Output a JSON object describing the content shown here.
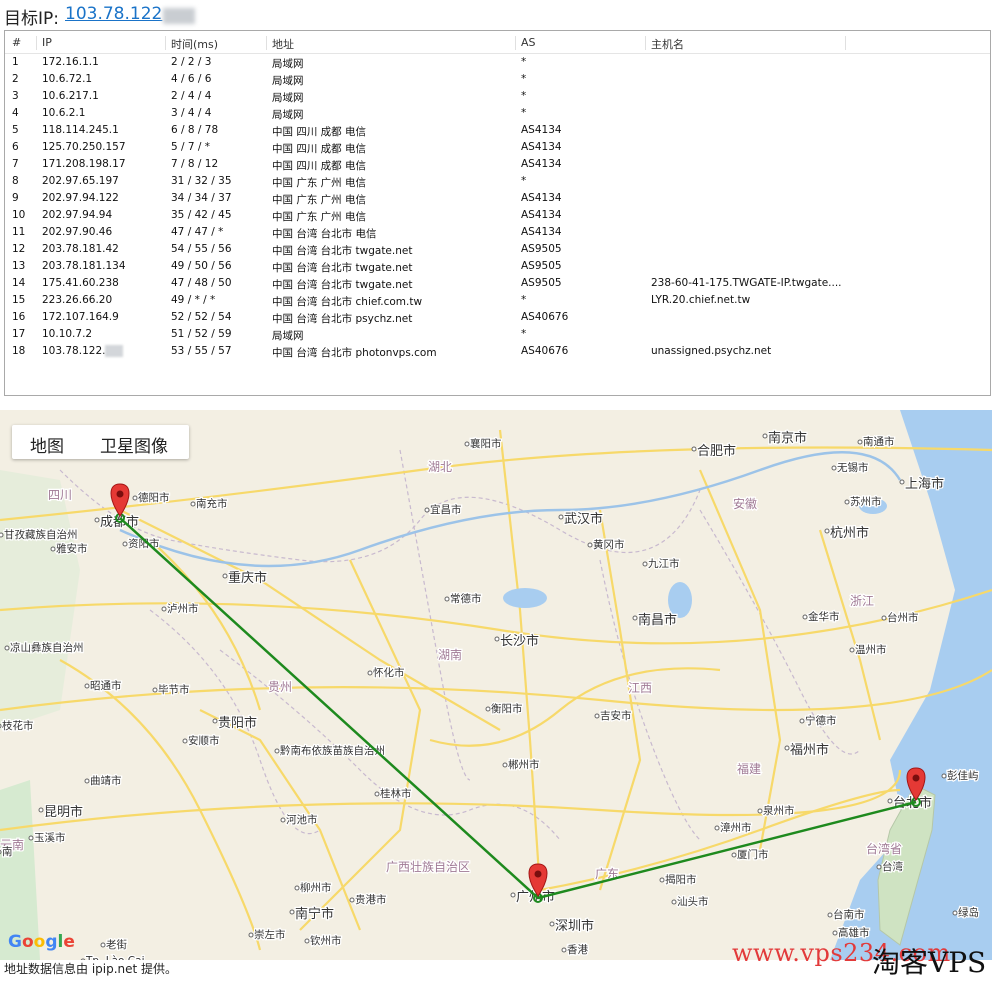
{
  "header": {
    "label": "目标IP:",
    "ip": "103.78.122"
  },
  "table": {
    "columns": [
      "#",
      "IP",
      "时间(ms)",
      "地址",
      "AS",
      "主机名"
    ],
    "rows": [
      [
        "1",
        "172.16.1.1",
        "2 / 2 / 3",
        "局域网",
        "*",
        ""
      ],
      [
        "2",
        "10.6.72.1",
        "4 / 6 / 6",
        "局域网",
        "*",
        ""
      ],
      [
        "3",
        "10.6.217.1",
        "2 / 4 / 4",
        "局域网",
        "*",
        ""
      ],
      [
        "4",
        "10.6.2.1",
        "3 / 4 / 4",
        "局域网",
        "*",
        ""
      ],
      [
        "5",
        "118.114.245.1",
        "6 / 8 / 78",
        "中国 四川 成都 电信",
        "AS4134",
        ""
      ],
      [
        "6",
        "125.70.250.157",
        "5 / 7 / *",
        "中国 四川 成都 电信",
        "AS4134",
        ""
      ],
      [
        "7",
        "171.208.198.17",
        "7 / 8 / 12",
        "中国 四川 成都 电信",
        "AS4134",
        ""
      ],
      [
        "8",
        "202.97.65.197",
        "31 / 32 / 35",
        "中国 广东 广州 电信",
        "*",
        ""
      ],
      [
        "9",
        "202.97.94.122",
        "34 / 34 / 37",
        "中国 广东 广州 电信",
        "AS4134",
        ""
      ],
      [
        "10",
        "202.97.94.94",
        "35 / 42 / 45",
        "中国 广东 广州 电信",
        "AS4134",
        ""
      ],
      [
        "11",
        "202.97.90.46",
        "47 / 47 / *",
        "中国 台湾 台北市 电信",
        "AS4134",
        ""
      ],
      [
        "12",
        "203.78.181.42",
        "54 / 55 / 56",
        "中国 台湾 台北市 twgate.net",
        "AS9505",
        ""
      ],
      [
        "13",
        "203.78.181.134",
        "49 / 50 / 56",
        "中国 台湾 台北市 twgate.net",
        "AS9505",
        ""
      ],
      [
        "14",
        "175.41.60.238",
        "47 / 48 / 50",
        "中国 台湾 台北市 twgate.net",
        "AS9505",
        "238-60-41-175.TWGATE-IP.twgate...."
      ],
      [
        "15",
        "223.26.66.20",
        "49 / * / *",
        "中国 台湾 台北市 chief.com.tw",
        "*",
        "LYR.20.chief.net.tw"
      ],
      [
        "16",
        "172.107.164.9",
        "52 / 52 / 54",
        "中国 台湾 台北市 psychz.net",
        "AS40676",
        ""
      ],
      [
        "17",
        "10.10.7.2",
        "51 / 52 / 59",
        "局域网",
        "*",
        ""
      ],
      [
        "18",
        "103.78.122.",
        "53 / 55 / 57",
        "中国 台湾 台北市 photonvps.com",
        "AS40676",
        "unassigned.psychz.net"
      ]
    ]
  },
  "map": {
    "tabs": [
      "地图",
      "卫星图像"
    ],
    "logo": "Google",
    "route_color": "#1e8a1e",
    "cities": [
      "成都市",
      "德阳市",
      "南充市",
      "资阳市",
      "重庆市",
      "泸州市",
      "雅安市",
      "凉山彝族自治州",
      "昭通市",
      "毕节市",
      "贵阳市",
      "安顺市",
      "黔南布依族苗族自治州",
      "曲靖市",
      "昆明市",
      "玉溪市",
      "枝花市",
      "河池市",
      "柳州市",
      "桂林市",
      "怀化市",
      "广西壮族自治区",
      "南宁市",
      "贵港市",
      "钦州市",
      "崇左市",
      "老街",
      "Tp. Lào Cai",
      "湖南",
      "长沙市",
      "衡阳市",
      "郴州市",
      "常德市",
      "襄阳市",
      "湖北",
      "宜昌市",
      "武汉市",
      "黄冈市",
      "合肥市",
      "安徽",
      "南京市",
      "南通市",
      "无锡市",
      "苏州市",
      "上海市",
      "杭州市",
      "浙江",
      "金华市",
      "台州市",
      "温州市",
      "九江市",
      "南昌市",
      "江西",
      "吉安市",
      "福建",
      "宁德市",
      "福州市",
      "泉州市",
      "漳州市",
      "厦门市",
      "揭阳市",
      "汕头市",
      "广东",
      "广州市",
      "深圳市",
      "香港",
      "台北市",
      "台湾省",
      "台湾",
      "台南市",
      "高雄市",
      "彭佳屿",
      "绿岛",
      "四川",
      "甘孜藏族自治州",
      "贵州",
      "云南",
      "南"
    ],
    "markers": [
      "成都市",
      "广州市",
      "台北市"
    ]
  },
  "footer": "地址数据信息由 ipip.net 提供。",
  "watermark": {
    "url": "www.vps234.com",
    "name": "淘客VPS"
  }
}
